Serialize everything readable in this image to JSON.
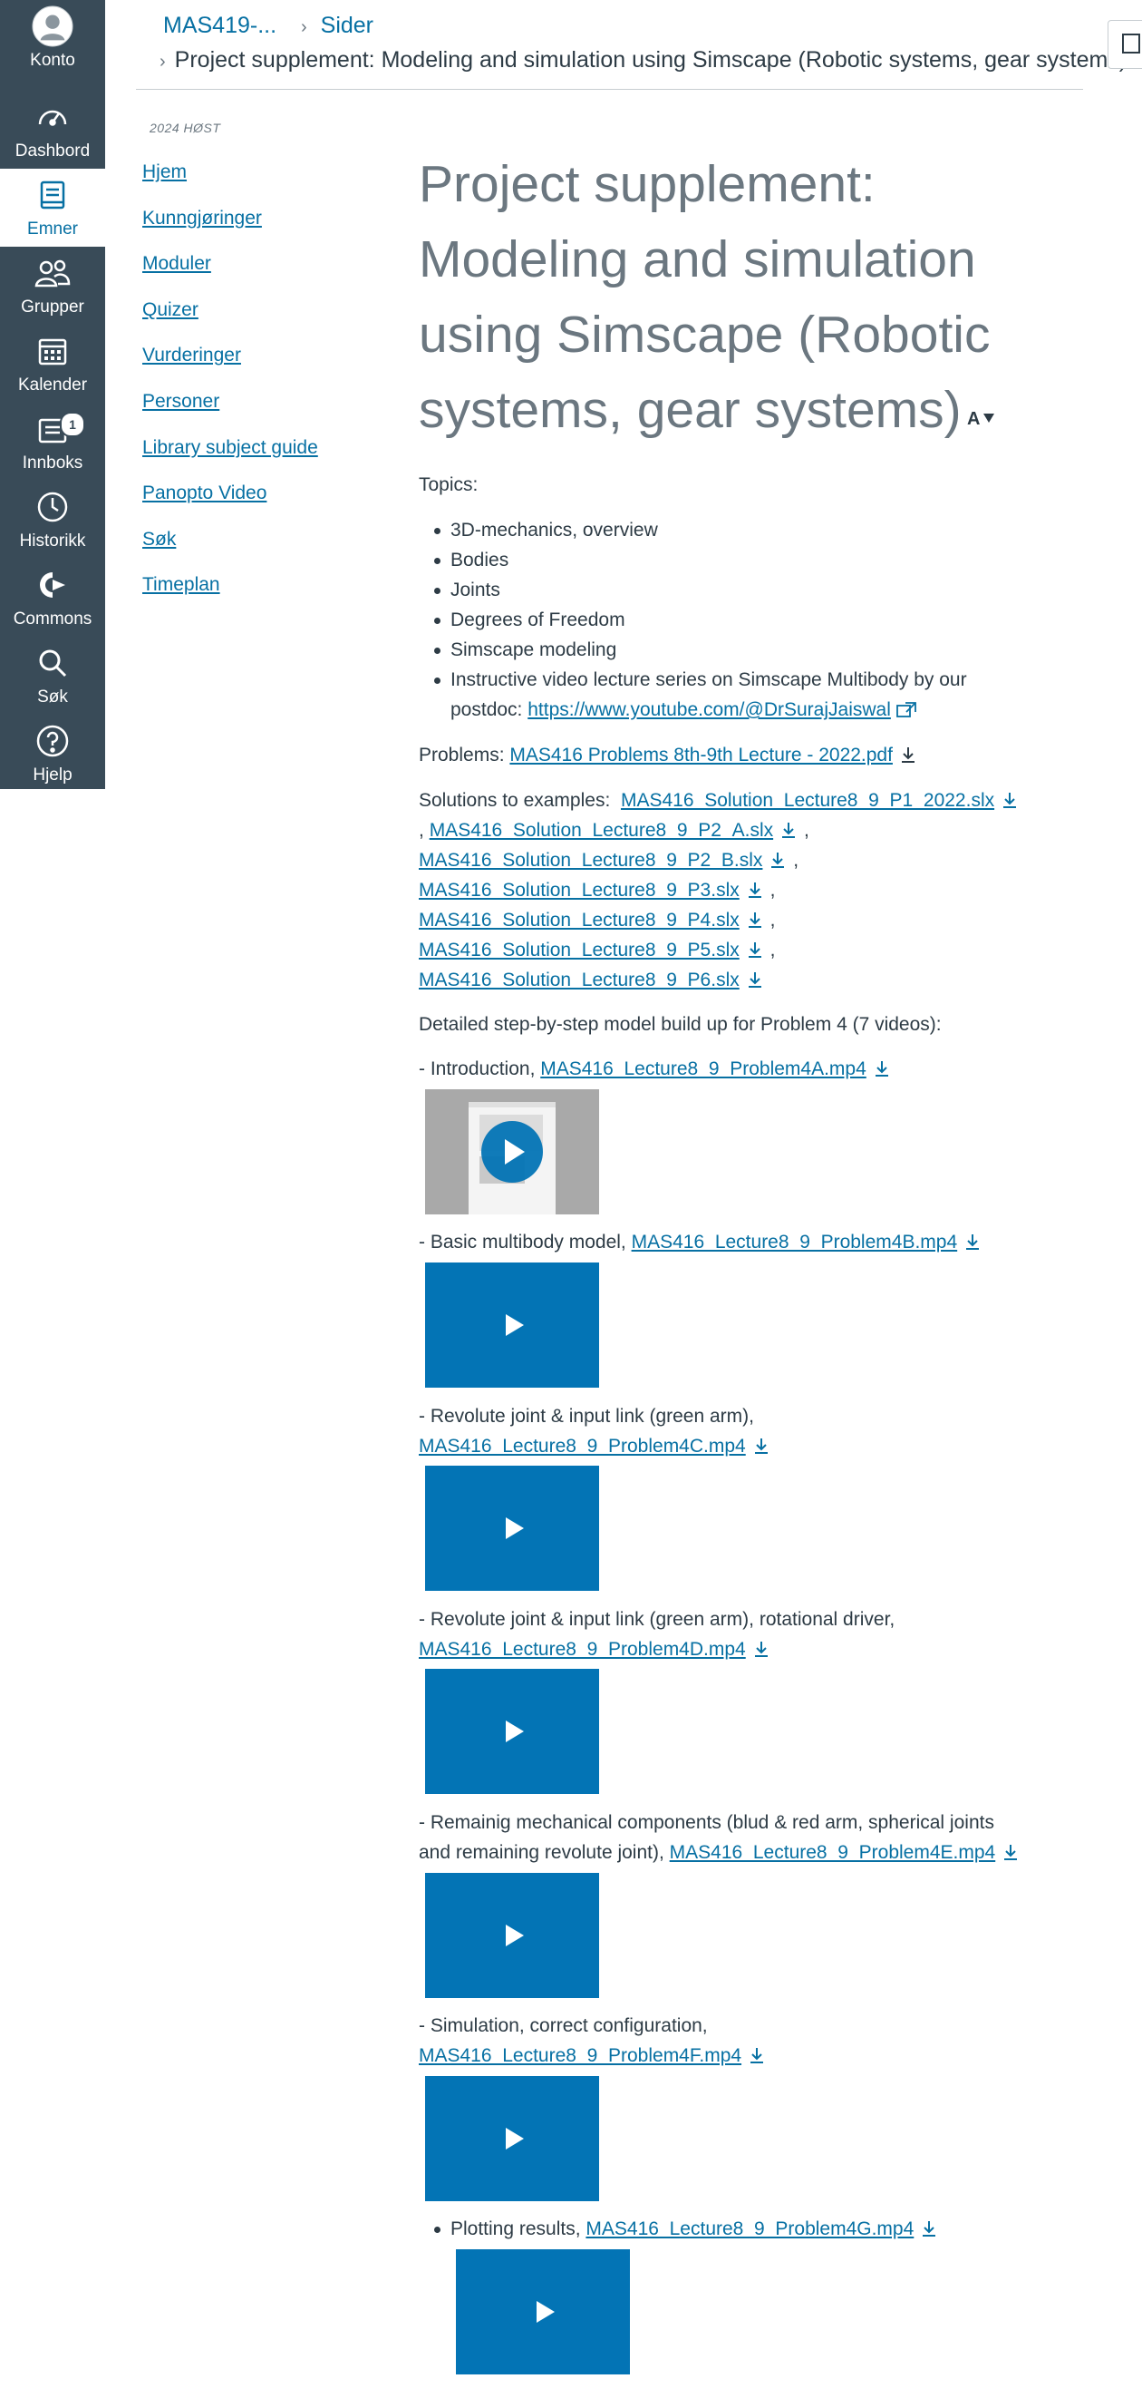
{
  "global_nav": {
    "items": [
      {
        "label": "Konto",
        "icon": "account-icon"
      },
      {
        "label": "Dashbord",
        "icon": "dashboard-icon"
      },
      {
        "label": "Emner",
        "icon": "courses-icon",
        "active": true
      },
      {
        "label": "Grupper",
        "icon": "groups-icon"
      },
      {
        "label": "Kalender",
        "icon": "calendar-icon"
      },
      {
        "label": "Innboks",
        "icon": "inbox-icon",
        "badge": "1"
      },
      {
        "label": "Historikk",
        "icon": "history-icon"
      },
      {
        "label": "Commons",
        "icon": "commons-icon"
      },
      {
        "label": "Søk",
        "icon": "search-icon"
      },
      {
        "label": "Hjelp",
        "icon": "help-icon"
      }
    ]
  },
  "breadcrumb": {
    "course": "MAS419-...",
    "section": "Sider",
    "page": "Project supplement: Modeling and simulation using Simscape (Robotic systems, gear systems)"
  },
  "course_nav": {
    "term": "2024 HØST",
    "items": [
      "Hjem",
      "Kunngjøringer",
      "Moduler",
      "Quizer",
      "Vurderinger",
      "Personer",
      "Library subject guide",
      "Panopto Video",
      "Søk",
      "Timeplan"
    ]
  },
  "page": {
    "title": "Project supplement: Modeling and simulation using Simscape (Robotic systems, gear systems)",
    "topics_heading": "Topics:",
    "topics": [
      "3D-mechanics, overview",
      "Bodies",
      "Joints",
      "Degrees of Freedom",
      "Simscape modeling",
      "Instructive video lecture series on Simscape Multibody by our"
    ],
    "topic_postdoc_prefix": "postdoc: ",
    "topic_postdoc_link": "https://www.youtube.com/@DrSurajJaiswal",
    "problems_label": "Problems: ",
    "problems_file": "MAS416 Problems 8th-9th Lecture - 2022.pdf",
    "solutions_label": "Solutions to examples:",
    "solutions_files": [
      "MAS416_Solution_Lecture8_9_P1_2022.slx",
      "MAS416_Solution_Lecture8_9_P2_A.slx",
      "MAS416_Solution_Lecture8_9_P2_B.slx",
      "MAS416_Solution_Lecture8_9_P3.slx",
      "MAS416_Solution_Lecture8_9_P4.slx",
      "MAS416_Solution_Lecture8_9_P5.slx",
      "MAS416_Solution_Lecture8_9_P6.slx"
    ],
    "separator": ",",
    "stepbystep_heading": "Detailed step-by-step model build up for Problem 4 (7 videos):",
    "videos": [
      {
        "desc": "- Introduction, ",
        "file": "MAS416_Lecture8_9_Problem4A.mp4"
      },
      {
        "desc": "- Basic multibody model, ",
        "file": "MAS416_Lecture8_9_Problem4B.mp4"
      },
      {
        "desc": "- Revolute joint & input link (green arm),",
        "file": "MAS416_Lecture8_9_Problem4C.mp4"
      },
      {
        "desc": "- Revolute joint & input link (green arm), rotational driver,",
        "file": "MAS416_Lecture8_9_Problem4D.mp4"
      },
      {
        "desc": "- Remainig mechanical components (blud & red arm, spherical joints",
        "desc2": "and remaining revolute joint), ",
        "file": "MAS416_Lecture8_9_Problem4E.mp4"
      },
      {
        "desc": "- Simulation, correct configuration,",
        "file": "MAS416_Lecture8_9_Problem4F.mp4"
      },
      {
        "desc": "Plotting results, ",
        "file": "MAS416_Lecture8_9_Problem4G.mp4"
      }
    ]
  },
  "colors": {
    "nav_bg": "#394b58",
    "link": "#0770a3",
    "video_bg": "#0374b5",
    "title": "#6b7780"
  }
}
